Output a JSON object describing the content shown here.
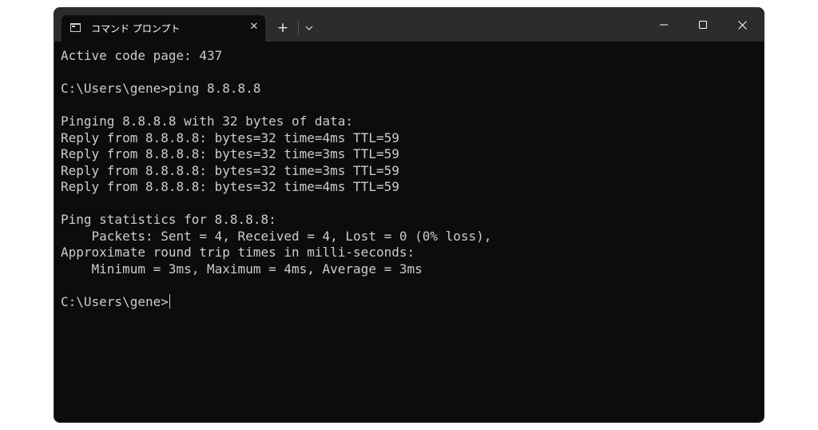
{
  "window": {
    "tab_title": "コマンド プロンプト",
    "tab_close_glyph": "✕",
    "new_tab_glyph": "+"
  },
  "console": {
    "lines": [
      "Active code page: 437",
      "",
      "C:\\Users\\gene>ping 8.8.8.8",
      "",
      "Pinging 8.8.8.8 with 32 bytes of data:",
      "Reply from 8.8.8.8: bytes=32 time=4ms TTL=59",
      "Reply from 8.8.8.8: bytes=32 time=3ms TTL=59",
      "Reply from 8.8.8.8: bytes=32 time=3ms TTL=59",
      "Reply from 8.8.8.8: bytes=32 time=4ms TTL=59",
      "",
      "Ping statistics for 8.8.8.8:",
      "    Packets: Sent = 4, Received = 4, Lost = 0 (0% loss),",
      "Approximate round trip times in milli-seconds:",
      "    Minimum = 3ms, Maximum = 4ms, Average = 3ms",
      ""
    ],
    "prompt": "C:\\Users\\gene>"
  },
  "colors": {
    "console_background": "#0c0c0c",
    "titlebar_background": "#2c2c2c",
    "console_text": "#cccccc"
  }
}
